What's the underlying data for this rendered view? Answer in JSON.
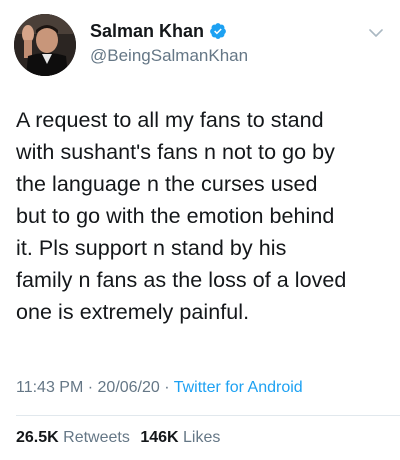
{
  "author": {
    "display_name": "Salman Khan",
    "handle": "@BeingSalmanKhan",
    "verified_icon": "verified-badge-icon",
    "avatar_icon": "profile-avatar"
  },
  "tweet": {
    "text": "A request to all my fans to stand\nwith sushant's fans n not to go by\nthe language n the curses used\nbut to go with the emotion behind\nit. Pls support n stand by his\nfamily n fans as the loss of a loved\none is extremely painful."
  },
  "meta": {
    "time": "11:43 PM",
    "separator1": " · ",
    "date": "20/06/20",
    "separator2": " · ",
    "source": "Twitter for Android"
  },
  "stats": {
    "retweets_count": "26.5K",
    "retweets_label": "Retweets",
    "likes_count": "146K",
    "likes_label": "Likes"
  },
  "colors": {
    "text": "#14171a",
    "secondary": "#657786",
    "accent": "#1da1f2",
    "divider": "#e1e8ed"
  },
  "icons": {
    "menu": "chevron-down-icon"
  }
}
